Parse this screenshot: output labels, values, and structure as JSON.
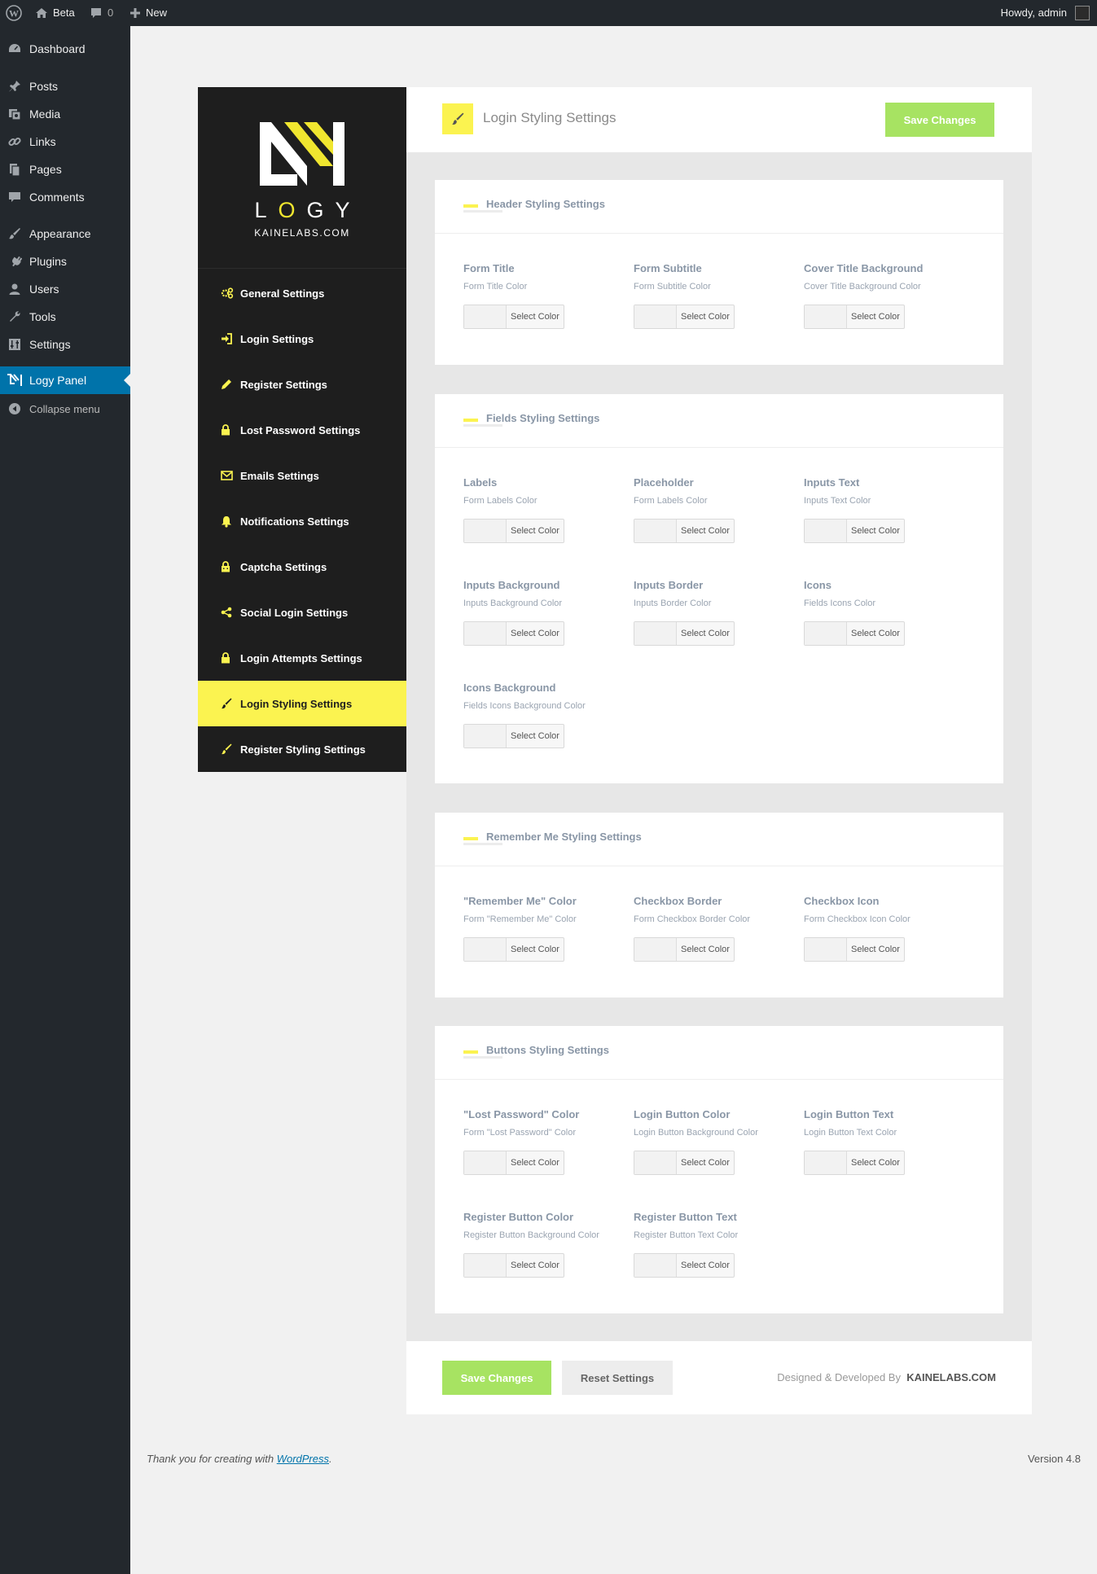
{
  "admin_bar": {
    "site_name": "Beta",
    "comments_count": "0",
    "new_label": "New",
    "greeting": "Howdy, admin"
  },
  "admin_menu": {
    "items": [
      {
        "label": "Dashboard",
        "icon": "dashboard-icon"
      },
      {
        "label": "Posts",
        "icon": "pin-icon"
      },
      {
        "label": "Media",
        "icon": "media-icon"
      },
      {
        "label": "Links",
        "icon": "link-icon"
      },
      {
        "label": "Pages",
        "icon": "page-icon"
      },
      {
        "label": "Comments",
        "icon": "comment-icon"
      },
      {
        "label": "Appearance",
        "icon": "brush-icon"
      },
      {
        "label": "Plugins",
        "icon": "plug-icon"
      },
      {
        "label": "Users",
        "icon": "user-icon"
      },
      {
        "label": "Tools",
        "icon": "wrench-icon"
      },
      {
        "label": "Settings",
        "icon": "sliders-icon"
      },
      {
        "label": "Logy Panel",
        "icon": "logy-icon",
        "current": true
      }
    ],
    "collapse_label": "Collapse menu"
  },
  "brand": {
    "wordmark_l": "L",
    "wordmark_o": "O",
    "wordmark_gy": "GY",
    "domain": "KAINELABS.COM",
    "accent_color": "#fbf350"
  },
  "panel_nav": [
    {
      "label": "General Settings",
      "icon": "gears-icon"
    },
    {
      "label": "Login Settings",
      "icon": "sign-in-icon"
    },
    {
      "label": "Register Settings",
      "icon": "pencil-icon"
    },
    {
      "label": "Lost Password Settings",
      "icon": "lock-icon"
    },
    {
      "label": "Emails Settings",
      "icon": "envelope-icon"
    },
    {
      "label": "Notifications Settings",
      "icon": "bell-icon"
    },
    {
      "label": "Captcha Settings",
      "icon": "captcha-lock-icon"
    },
    {
      "label": "Social Login Settings",
      "icon": "share-icon"
    },
    {
      "label": "Login Attempts Settings",
      "icon": "lock-icon"
    },
    {
      "label": "Login Styling Settings",
      "icon": "brush-icon",
      "active": true
    },
    {
      "label": "Register Styling Settings",
      "icon": "brush-icon"
    }
  ],
  "page_header": {
    "title": "Login Styling Settings",
    "save_label": "Save Changes"
  },
  "sections": {
    "header": {
      "title": "Header Styling Settings",
      "fields": [
        {
          "label": "Form Title",
          "desc": "Form Title Color",
          "button": "Select Color"
        },
        {
          "label": "Form Subtitle",
          "desc": "Form Subtitle Color",
          "button": "Select Color"
        },
        {
          "label": "Cover Title Background",
          "desc": "Cover Title Background Color",
          "button": "Select Color"
        }
      ]
    },
    "fields": {
      "title": "Fields Styling Settings",
      "fields": [
        {
          "label": "Labels",
          "desc": "Form Labels Color",
          "button": "Select Color"
        },
        {
          "label": "Placeholder",
          "desc": "Form Labels Color",
          "button": "Select Color"
        },
        {
          "label": "Inputs Text",
          "desc": "Inputs Text Color",
          "button": "Select Color"
        },
        {
          "label": "Inputs Background",
          "desc": "Inputs Background Color",
          "button": "Select Color"
        },
        {
          "label": "Inputs Border",
          "desc": "Inputs Border Color",
          "button": "Select Color"
        },
        {
          "label": "Icons",
          "desc": "Fields Icons Color",
          "button": "Select Color"
        },
        {
          "label": "Icons Background",
          "desc": "Fields Icons Background Color",
          "button": "Select Color"
        }
      ]
    },
    "remember": {
      "title": "Remember Me Styling Settings",
      "fields": [
        {
          "label": "\"Remember Me\" Color",
          "desc": "Form \"Remember Me\" Color",
          "button": "Select Color"
        },
        {
          "label": "Checkbox Border",
          "desc": "Form Checkbox Border Color",
          "button": "Select Color"
        },
        {
          "label": "Checkbox Icon",
          "desc": "Form Checkbox Icon Color",
          "button": "Select Color"
        }
      ]
    },
    "buttons": {
      "title": "Buttons Styling Settings",
      "fields": [
        {
          "label": "\"Lost Password\" Color",
          "desc": "Form \"Lost Password\" Color",
          "button": "Select Color"
        },
        {
          "label": "Login Button Color",
          "desc": "Login Button Background Color",
          "button": "Select Color"
        },
        {
          "label": "Login Button Text",
          "desc": "Login Button Text Color",
          "button": "Select Color"
        },
        {
          "label": "Register Button Color",
          "desc": "Register Button Background Color",
          "button": "Select Color"
        },
        {
          "label": "Register Button Text",
          "desc": "Register Button Text Color",
          "button": "Select Color"
        }
      ]
    }
  },
  "panel_footer": {
    "save_label": "Save Changes",
    "reset_label": "Reset Settings",
    "credit_text": "Designed & Developed By",
    "credit_brand": "KAINELABS.COM"
  },
  "wp_footer": {
    "thanks_text": "Thank you for creating with",
    "thanks_link": "WordPress",
    "thanks_end": ".",
    "version": "Version 4.8"
  }
}
